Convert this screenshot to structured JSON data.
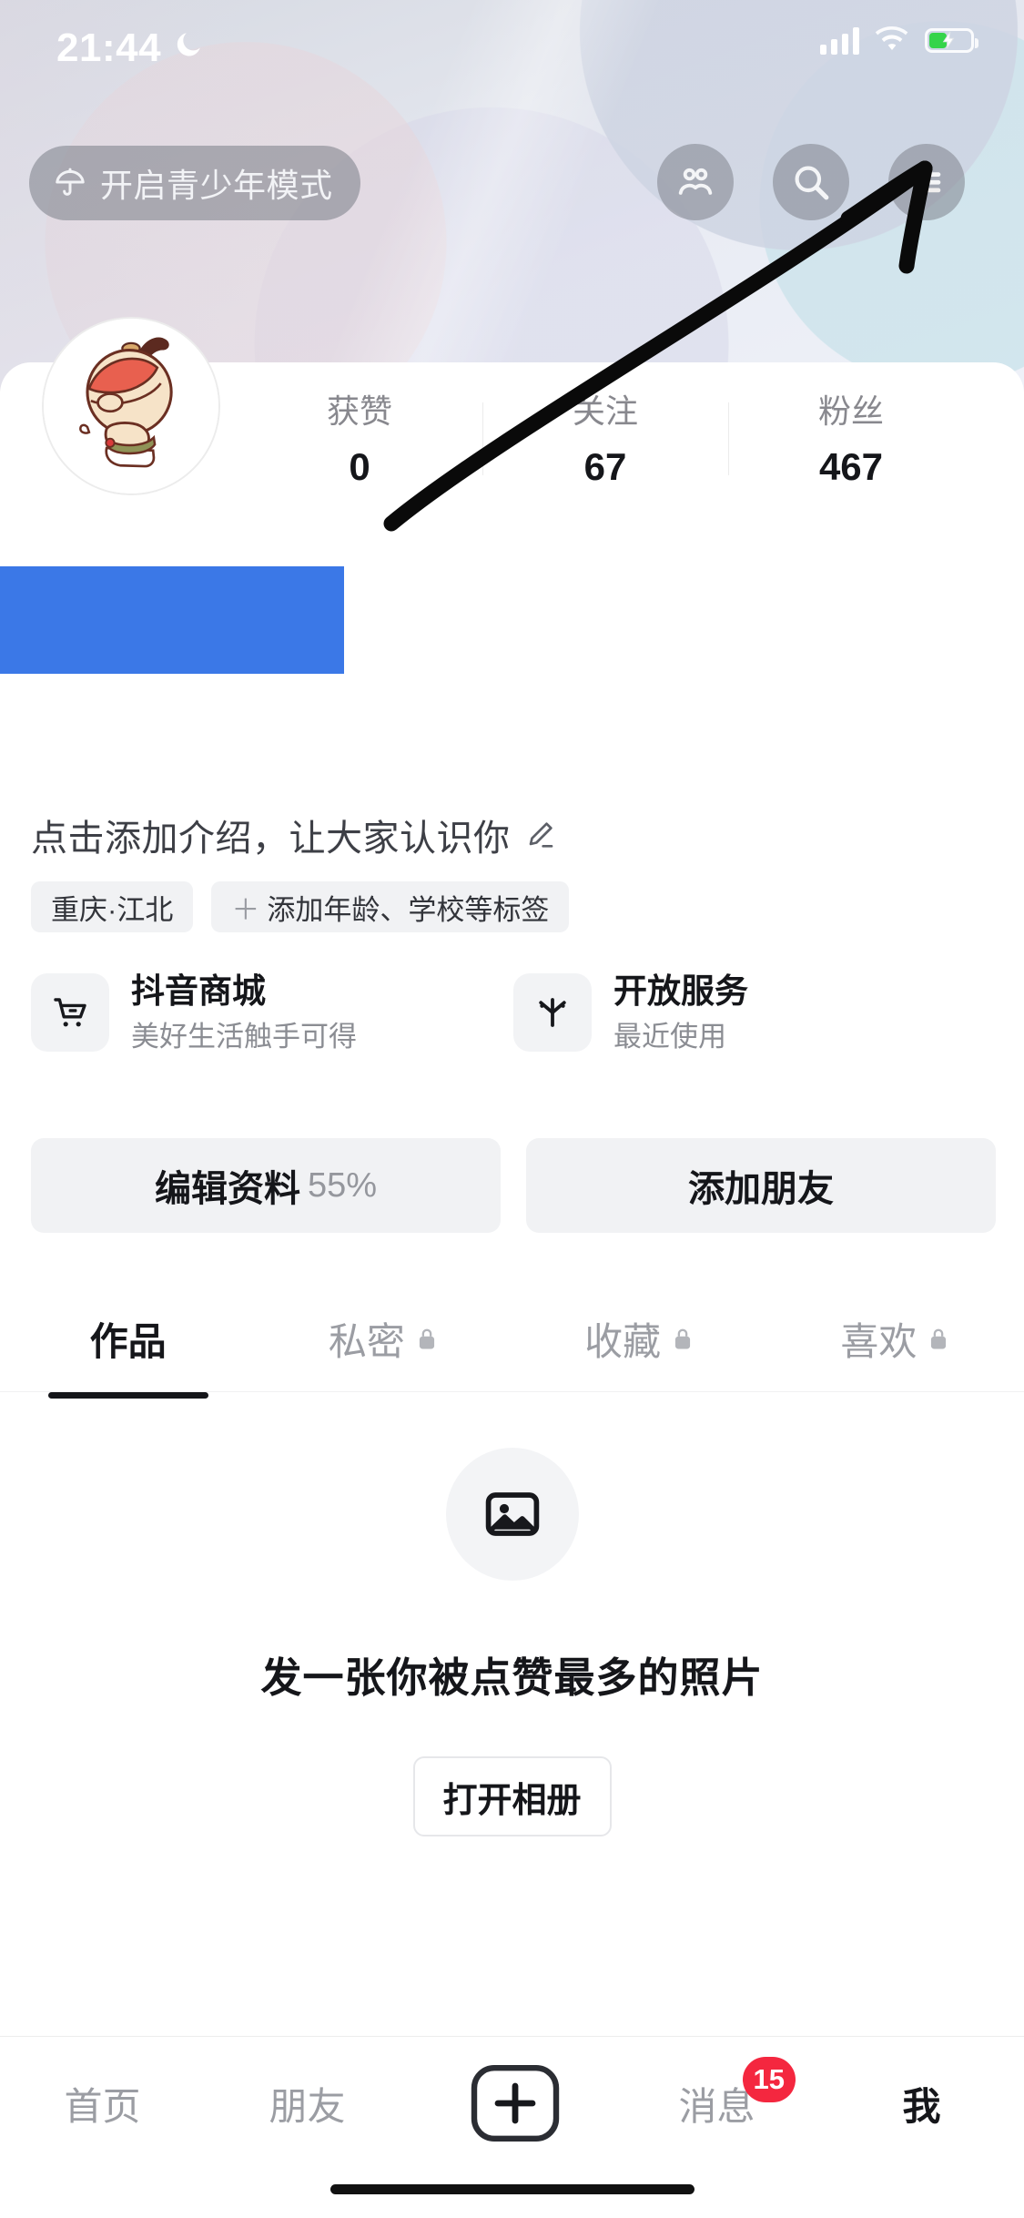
{
  "status_bar": {
    "time": "21:44",
    "dnd_icon": "moon-icon",
    "signal_icon": "signal-bars-icon",
    "wifi_icon": "wifi-icon",
    "battery_icon": "battery-charging-icon"
  },
  "header": {
    "teen_mode_label": "开启青少年模式",
    "teen_mode_icon": "umbrella-icon",
    "friends_icon": "friends-icon",
    "search_icon": "search-icon",
    "menu_icon": "hamburger-menu-icon"
  },
  "profile": {
    "avatar_icon": "cartoon-avatar",
    "username_redacted": "",
    "stats": [
      {
        "key": "获赞",
        "value": "0"
      },
      {
        "key": "关注",
        "value": "67"
      },
      {
        "key": "粉丝",
        "value": "467"
      }
    ],
    "bio_placeholder": "点击添加介绍，让大家认识你",
    "bio_edit_icon": "pencil-edit-icon",
    "tags": [
      {
        "label": "重庆·江北",
        "has_plus": false
      },
      {
        "label": "添加年龄、学校等标签",
        "has_plus": true
      }
    ],
    "cards": [
      {
        "icon": "shopping-cart-icon",
        "title": "抖音商城",
        "subtitle": "美好生活触手可得"
      },
      {
        "icon": "douyin-star-icon",
        "title": "开放服务",
        "subtitle": "最近使用"
      }
    ],
    "actions": {
      "edit_profile_label": "编辑资料",
      "edit_profile_percent": "55%",
      "add_friend_label": "添加朋友"
    }
  },
  "tabs": [
    {
      "label": "作品",
      "locked": false,
      "active": true
    },
    {
      "label": "私密",
      "locked": true,
      "active": false
    },
    {
      "label": "收藏",
      "locked": true,
      "active": false
    },
    {
      "label": "喜欢",
      "locked": true,
      "active": false
    }
  ],
  "empty_state": {
    "icon": "image-placeholder-icon",
    "message": "发一张你被点赞最多的照片",
    "button_label": "打开相册"
  },
  "bottom_nav": {
    "items": [
      {
        "label": "首页",
        "active": false
      },
      {
        "label": "朋友",
        "active": false
      },
      {
        "label": "我",
        "active": true
      }
    ],
    "create_icon": "plus-icon",
    "messages_label": "消息",
    "messages_badge": "15"
  },
  "colors": {
    "redaction_blue": "#3b78e7",
    "badge_red": "#f4273f",
    "accent_dark": "#15161a",
    "muted_text": "#9b9da3",
    "chip_bg": "#f1f2f4",
    "battery_green": "#35d44a"
  }
}
